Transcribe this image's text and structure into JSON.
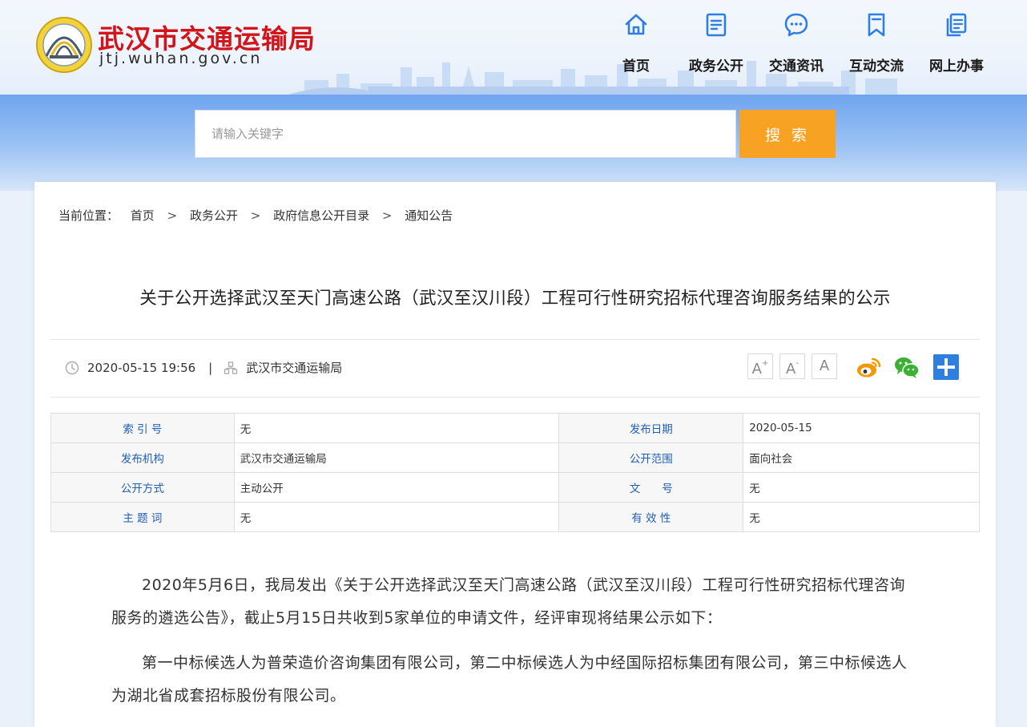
{
  "site": {
    "title": "武汉市交通运输局",
    "domain": "jtj.wuhan.gov.cn"
  },
  "nav": [
    {
      "label": "首页",
      "icon": "home-icon"
    },
    {
      "label": "政务公开",
      "icon": "document-icon"
    },
    {
      "label": "交通资讯",
      "icon": "chat-bubble-icon"
    },
    {
      "label": "互动交流",
      "icon": "bookmark-icon"
    },
    {
      "label": "网上办事",
      "icon": "copy-document-icon"
    }
  ],
  "search": {
    "placeholder": "请输入关键字",
    "value": "",
    "button_label": "搜 索"
  },
  "breadcrumb": {
    "prefix": "当前位置：",
    "items": [
      "首页",
      "政务公开",
      "政府信息公开目录",
      "通知公告"
    ],
    "separator": ">"
  },
  "article": {
    "title": "关于公开选择武汉至天门高速公路（武汉至汉川段）工程可行性研究招标代理咨询服务结果的公示",
    "datetime": "2020-05-15 19:56",
    "meta_separator": "|",
    "publisher": "武汉市交通运输局",
    "paragraphs": [
      "2020年5月6日，我局发出《关于公开选择武汉至天门高速公路（武汉至汉川段）工程可行性研究招标代理咨询服务的遴选公告》，截止5月15日共收到5家单位的申请文件，经评审现将结果公示如下：",
      "第一中标候选人为普荣造价咨询集团有限公司，第二中标候选人为中经国际招标集团有限公司，第三中标候选人为湖北省成套招标股份有限公司。"
    ]
  },
  "font_controls": {
    "increase": "A",
    "decrease": "A",
    "reset": "A",
    "increase_mark": "+",
    "decrease_mark": "-"
  },
  "share": [
    "weibo-icon",
    "wechat-icon",
    "more-share-icon"
  ],
  "info_table": [
    [
      {
        "label": "索 引 号",
        "value": "无"
      },
      {
        "label": "发布日期",
        "value": "2020-05-15"
      }
    ],
    [
      {
        "label": "发布机构",
        "value": "武汉市交通运输局"
      },
      {
        "label": "公开范围",
        "value": "面向社会"
      }
    ],
    [
      {
        "label": "公开方式",
        "value": "主动公开"
      },
      {
        "label": "文　　号",
        "value": "无"
      }
    ],
    [
      {
        "label": "主 题 词",
        "value": "无"
      },
      {
        "label": "有 效 性",
        "value": "无"
      }
    ]
  ],
  "colors": {
    "brand_red": "#d2141b",
    "nav_icon_blue": "#2f7fe0",
    "search_orange": "#f7a223",
    "table_key_blue": "#1f5fb4",
    "weibo_orange": "#f39800",
    "wechat_green": "#3bb034",
    "share_blue": "#2f7fe0"
  }
}
